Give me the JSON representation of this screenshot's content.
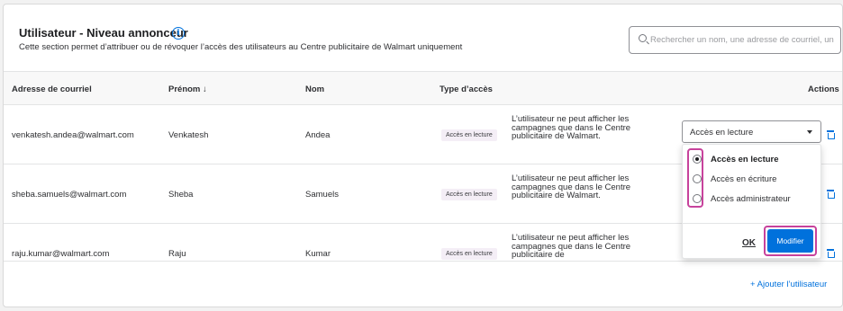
{
  "header": {
    "title": "Utilisateur - Niveau annonceur",
    "info_glyph": "i",
    "subtitle": "Cette section permet d’attribuer ou de révoquer l’accès des utilisateurs au Centre publicitaire de Walmart uniquement"
  },
  "search": {
    "placeholder": "Rechercher un nom, une adresse de courriel, un"
  },
  "table": {
    "columns": {
      "email": "Adresse de courriel",
      "first_name": "Prénom ↓",
      "last_name": "Nom",
      "access_type": "Type d’accès",
      "actions": "Actions"
    },
    "rows": [
      {
        "email": "venkatesh.andea@walmart.com",
        "first_name": "Venkatesh",
        "last_name": "Andea",
        "access_badge": "Accès en lecture",
        "description": "L’utilisateur ne peut afficher les campagnes que dans le Centre publicitaire de Walmart."
      },
      {
        "email": "sheba.samuels@walmart.com",
        "first_name": "Sheba",
        "last_name": "Samuels",
        "access_badge": "Accès en lecture",
        "description": "L’utilisateur ne peut afficher les campagnes que dans le Centre publicitaire de Walmart."
      },
      {
        "email": "raju.kumar@walmart.com",
        "first_name": "Raju",
        "last_name": "Kumar",
        "access_badge": "Accès en lecture",
        "description": "L’utilisateur ne peut afficher les campagnes que dans le Centre publicitaire de"
      }
    ]
  },
  "access_select": {
    "selected": "Accès en lecture",
    "options": [
      {
        "label": "Accès en lecture",
        "checked": true
      },
      {
        "label": "Accès en écriture",
        "checked": false
      },
      {
        "label": "Accès administrateur",
        "checked": false
      }
    ],
    "ok_label": "OK",
    "modify_label": "Modifier"
  },
  "footer": {
    "add_user_label": "+ Ajouter l’utilisateur"
  },
  "colors": {
    "accent": "#0071dc",
    "highlight": "#c7429c",
    "badge_bg": "#f4eef6"
  },
  "icons": {
    "info": "info-icon",
    "search": "search-icon",
    "delete": "trash-icon",
    "dropdown": "chevron-down-icon"
  }
}
